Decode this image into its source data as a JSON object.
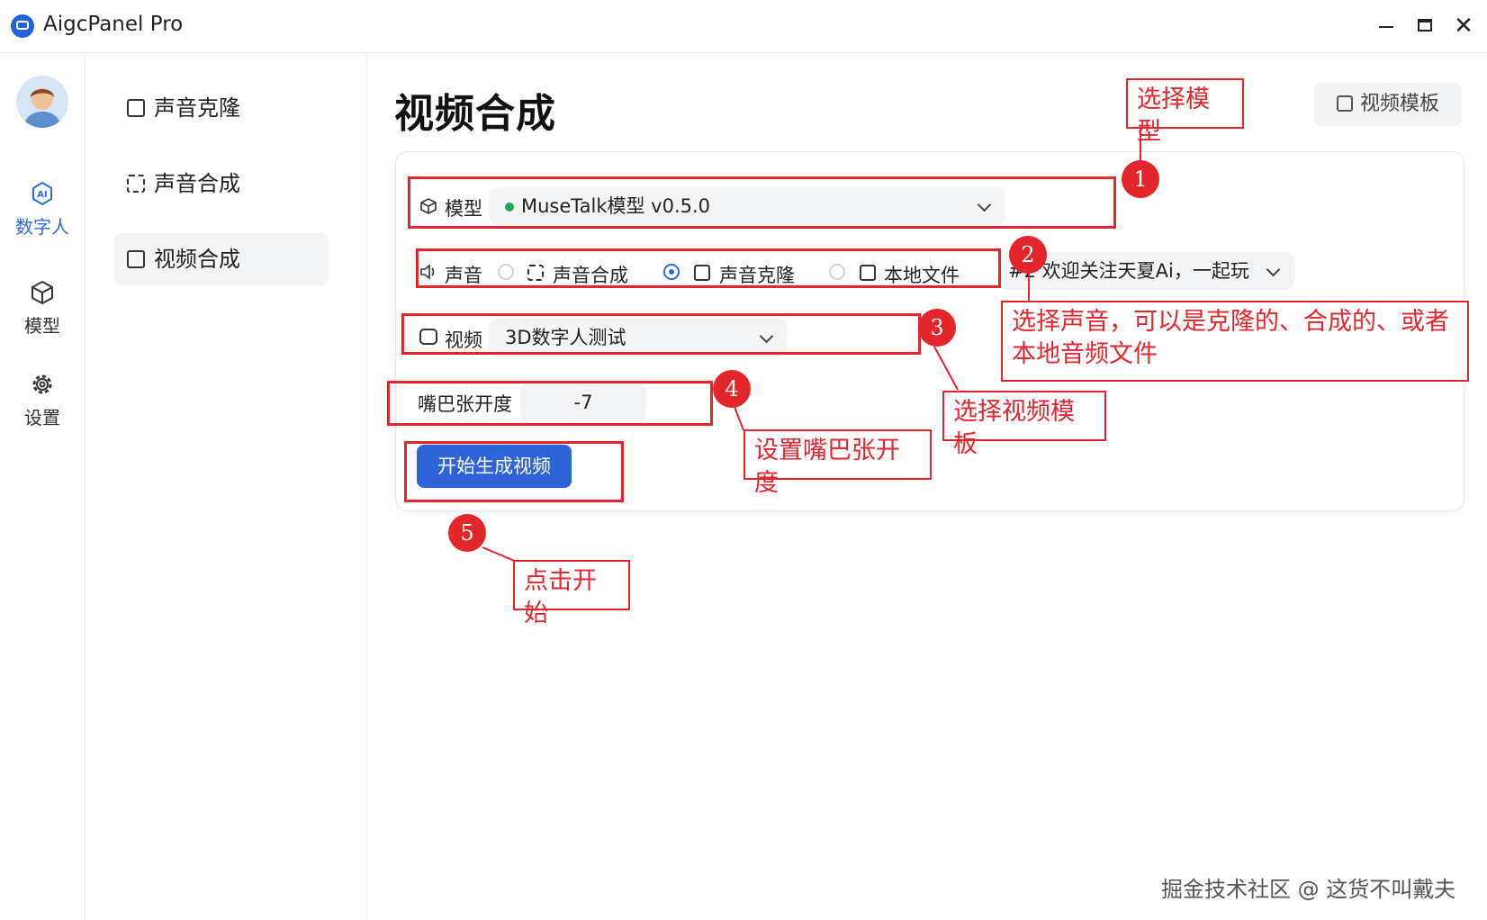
{
  "window": {
    "title": "AigcPanel Pro"
  },
  "left_nav": [
    {
      "label": "数字人",
      "icon": "ai-icon",
      "active": true
    },
    {
      "label": "模型",
      "icon": "cube-icon",
      "active": false
    },
    {
      "label": "设置",
      "icon": "gear-icon",
      "active": false
    }
  ],
  "sub_nav": [
    {
      "label": "声音克隆",
      "active": false
    },
    {
      "label": "声音合成",
      "active": false
    },
    {
      "label": "视频合成",
      "active": true
    }
  ],
  "main": {
    "title": "视频合成",
    "template_button": "视频模板",
    "model": {
      "label": "模型",
      "value": "MuseTalk模型 v0.5.0"
    },
    "sound": {
      "label": "声音",
      "options": [
        {
          "label": "声音合成",
          "selected": false
        },
        {
          "label": "声音克隆",
          "selected": true
        },
        {
          "label": "本地文件",
          "selected": false
        }
      ],
      "value": "#2 欢迎关注天夏Ai，一起玩"
    },
    "video": {
      "label": "视频",
      "value": "3D数字人测试"
    },
    "mouth": {
      "label": "嘴巴张开度",
      "value": "-7"
    },
    "start_button": "开始生成视频"
  },
  "annotations": [
    {
      "number": "1",
      "text": "选择模型"
    },
    {
      "number": "2",
      "text": "选择声音，可以是克隆的、合成的、或者本地音频文件"
    },
    {
      "number": "3",
      "text": "选择视频模板"
    },
    {
      "number": "4",
      "text": "设置嘴巴张开度"
    },
    {
      "number": "5",
      "text": "点击开始"
    }
  ],
  "watermark": "掘金技术社区 @ 这货不叫戴夫",
  "colors": {
    "accent": "#2f63d8",
    "annotation": "#e3262c",
    "status_green": "#22a55a"
  }
}
